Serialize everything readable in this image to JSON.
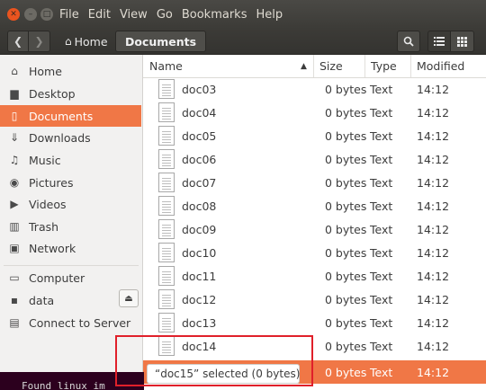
{
  "window": {
    "menu": [
      "File",
      "Edit",
      "View",
      "Go",
      "Bookmarks",
      "Help"
    ]
  },
  "toolbar": {
    "home_label": "Home",
    "current_folder": "Documents"
  },
  "sidebar": {
    "places": [
      {
        "label": "Home",
        "icon": "home-icon"
      },
      {
        "label": "Desktop",
        "icon": "folder-icon"
      },
      {
        "label": "Documents",
        "icon": "document-icon",
        "active": true
      },
      {
        "label": "Downloads",
        "icon": "download-icon"
      },
      {
        "label": "Music",
        "icon": "music-icon"
      },
      {
        "label": "Pictures",
        "icon": "camera-icon"
      },
      {
        "label": "Videos",
        "icon": "video-icon"
      },
      {
        "label": "Trash",
        "icon": "trash-icon"
      },
      {
        "label": "Network",
        "icon": "network-icon"
      }
    ],
    "devices": [
      {
        "label": "Computer",
        "icon": "computer-icon"
      },
      {
        "label": "data",
        "icon": "drive-icon"
      },
      {
        "label": "Connect to Server",
        "icon": "server-icon"
      }
    ]
  },
  "columns": {
    "name": "Name",
    "size": "Size",
    "type": "Type",
    "modified": "Modified"
  },
  "files": [
    {
      "name": "doc03",
      "size": "0 bytes",
      "type": "Text",
      "modified": "14:12"
    },
    {
      "name": "doc04",
      "size": "0 bytes",
      "type": "Text",
      "modified": "14:12"
    },
    {
      "name": "doc05",
      "size": "0 bytes",
      "type": "Text",
      "modified": "14:12"
    },
    {
      "name": "doc06",
      "size": "0 bytes",
      "type": "Text",
      "modified": "14:12"
    },
    {
      "name": "doc07",
      "size": "0 bytes",
      "type": "Text",
      "modified": "14:12"
    },
    {
      "name": "doc08",
      "size": "0 bytes",
      "type": "Text",
      "modified": "14:12"
    },
    {
      "name": "doc09",
      "size": "0 bytes",
      "type": "Text",
      "modified": "14:12"
    },
    {
      "name": "doc10",
      "size": "0 bytes",
      "type": "Text",
      "modified": "14:12"
    },
    {
      "name": "doc11",
      "size": "0 bytes",
      "type": "Text",
      "modified": "14:12"
    },
    {
      "name": "doc12",
      "size": "0 bytes",
      "type": "Text",
      "modified": "14:12"
    },
    {
      "name": "doc13",
      "size": "0 bytes",
      "type": "Text",
      "modified": "14:12"
    },
    {
      "name": "doc14",
      "size": "0 bytes",
      "type": "Text",
      "modified": "14:12"
    },
    {
      "name": "",
      "size": "0 bytes",
      "type": "Text",
      "modified": "14:12",
      "selected": true
    }
  ],
  "status": "“doc15” selected  (0 bytes)",
  "terminal_text": "Found linux im",
  "colors": {
    "accent": "#f07746",
    "annotation": "#e0202a"
  }
}
